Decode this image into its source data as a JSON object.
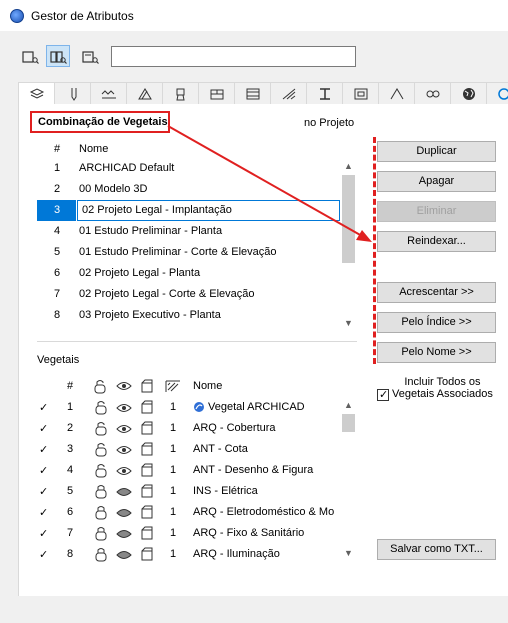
{
  "window": {
    "title": "Gestor de Atributos"
  },
  "search": {
    "value": ""
  },
  "combination": {
    "label": "Combinação de Vegetais",
    "scope": "no Projeto"
  },
  "list1": {
    "headers": {
      "num": "#",
      "name": "Nome"
    },
    "rows": [
      {
        "num": "1",
        "name": "ARCHICAD Default"
      },
      {
        "num": "2",
        "name": "00 Modelo 3D"
      },
      {
        "num": "3",
        "name": "02 Projeto Legal - Implantação"
      },
      {
        "num": "4",
        "name": "01 Estudo Preliminar - Planta"
      },
      {
        "num": "5",
        "name": "01 Estudo Preliminar - Corte & Elevação"
      },
      {
        "num": "6",
        "name": "02 Projeto Legal - Planta"
      },
      {
        "num": "7",
        "name": "02 Projeto Legal - Corte & Elevação"
      },
      {
        "num": "8",
        "name": "03 Projeto Executivo - Planta"
      }
    ]
  },
  "layers": {
    "label": "Vegetais",
    "headers": {
      "num": "#",
      "name": "Nome"
    },
    "rows": [
      {
        "checked": "✓",
        "num": "1",
        "pen": "1",
        "name": "Vegetal ARCHICAD"
      },
      {
        "checked": "✓",
        "num": "2",
        "pen": "1",
        "name": "ARQ - Cobertura"
      },
      {
        "checked": "✓",
        "num": "3",
        "pen": "1",
        "name": "ANT - Cota"
      },
      {
        "checked": "✓",
        "num": "4",
        "pen": "1",
        "name": "ANT - Desenho & Figura"
      },
      {
        "checked": "✓",
        "num": "5",
        "pen": "1",
        "name": "INS - Elétrica"
      },
      {
        "checked": "✓",
        "num": "6",
        "pen": "1",
        "name": "ARQ - Eletrodoméstico & Mo"
      },
      {
        "checked": "✓",
        "num": "7",
        "pen": "1",
        "name": "ARQ - Fixo & Sanitário"
      },
      {
        "checked": "✓",
        "num": "8",
        "pen": "1",
        "name": "ARQ - Iluminação"
      }
    ]
  },
  "buttons": {
    "duplicar": "Duplicar",
    "apagar": "Apagar",
    "eliminar": "Eliminar",
    "reindexar": "Reindexar...",
    "acrescentar": "Acrescentar >>",
    "pelo_indice": "Pelo Índice >>",
    "pelo_nome": "Pelo Nome >>",
    "salvar": "Salvar como TXT..."
  },
  "include_checkbox": {
    "line1": "Incluir Todos os",
    "line2": "Vegetais Associados",
    "checked": "✓"
  },
  "colors": {
    "accent": "#0078d7",
    "annotation": "#e02020"
  }
}
